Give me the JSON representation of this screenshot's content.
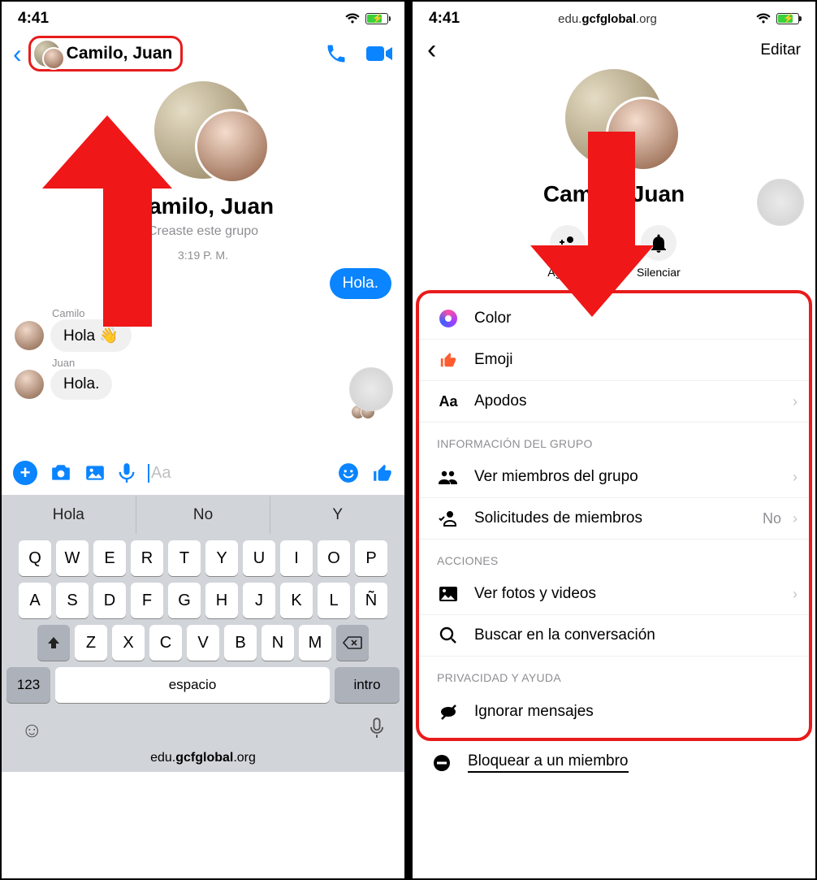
{
  "status_time": "4:41",
  "url_prefix": "edu.",
  "url_bold": "gcfglobal",
  "url_suffix": ".org",
  "left": {
    "header_title": "Camilo, Juan",
    "group_name": "Camilo, Juan",
    "created_text": "Creaste este grupo",
    "timestamp": "3:19 P. M.",
    "out_msg": "Hola.",
    "sender1": "Camilo",
    "msg1": "Hola 👋",
    "sender2": "Juan",
    "msg2": "Hola.",
    "placeholder": "Aa",
    "suggestions": [
      "Hola",
      "No",
      "Y"
    ],
    "row1": [
      "Q",
      "W",
      "E",
      "R",
      "T",
      "Y",
      "U",
      "I",
      "O",
      "P"
    ],
    "row2": [
      "A",
      "S",
      "D",
      "F",
      "G",
      "H",
      "J",
      "K",
      "L",
      "Ñ"
    ],
    "row3": [
      "Z",
      "X",
      "C",
      "V",
      "B",
      "N",
      "M"
    ],
    "key_123": "123",
    "key_space": "espacio",
    "key_intro": "intro"
  },
  "right": {
    "edit": "Editar",
    "group_name": "Camilo, Juan",
    "add": "Agregar",
    "mute": "Silenciar",
    "opt_color": "Color",
    "opt_emoji": "Emoji",
    "opt_nick": "Apodos",
    "sect_info": "Información del grupo",
    "opt_members": "Ver miembros del grupo",
    "opt_requests": "Solicitudes de miembros",
    "req_val": "No",
    "sect_actions": "Acciones",
    "opt_photos": "Ver fotos y videos",
    "opt_search": "Buscar en la conversación",
    "sect_privacy": "Privacidad y ayuda",
    "opt_ignore": "Ignorar mensajes",
    "opt_block": "Bloquear a un miembro"
  }
}
